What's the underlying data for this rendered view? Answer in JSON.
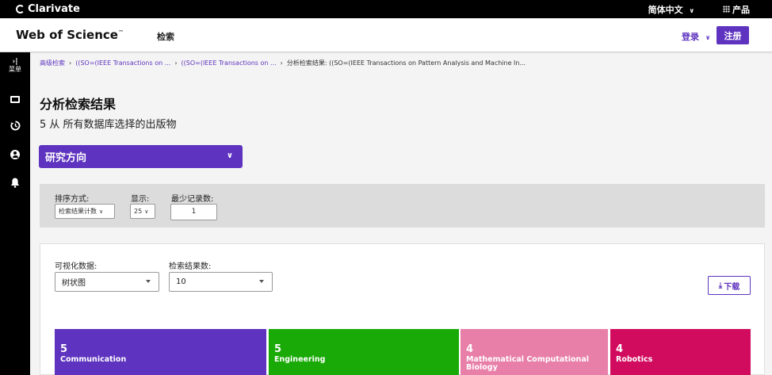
{
  "topbar": {
    "brand": "Clarivate",
    "language": "简体中文",
    "products": "产品"
  },
  "header": {
    "logo": "Web of Science",
    "trademark": "™",
    "nav_search": "检索",
    "login": "登录",
    "register": "注册"
  },
  "sidebar": {
    "menu_label": "菜单",
    "icons": [
      "expand-menu-icon",
      "folder-icon",
      "history-icon",
      "user-icon",
      "bell-icon"
    ]
  },
  "breadcrumb": {
    "items": [
      "高级检索",
      "((SO=(IEEE Transactions on ...",
      "((SO=(IEEE Transactions on ...",
      "分析检索结果: ((SO=(IEEE Transactions on Pattern Analysis and Machine In..."
    ]
  },
  "page": {
    "title": "分析检索结果",
    "subtitle": "5 从 所有数据库选择的出版物"
  },
  "research_dropdown": {
    "label": "研究方向"
  },
  "filters": {
    "sort_label": "排序方式:",
    "sort_value": "检索结果计数",
    "show_label": "显示:",
    "show_value": "25",
    "min_label": "最少记录数:",
    "min_value": "1"
  },
  "viz": {
    "data_label": "可视化数据:",
    "data_value": "树状图",
    "count_label": "检索结果数:",
    "count_value": "10",
    "download_label": "下载"
  },
  "treemap": [
    {
      "count": "5",
      "name": "Communication",
      "color": "#5e33bf"
    },
    {
      "count": "5",
      "name": "Engineering",
      "color": "#1aaa08"
    },
    {
      "count": "4",
      "name": "Mathematical Computational Biology",
      "color": "#e87fa9"
    },
    {
      "count": "4",
      "name": "Robotics",
      "color": "#d10c5f"
    }
  ],
  "colors": {
    "accent": "#5e33bf"
  }
}
